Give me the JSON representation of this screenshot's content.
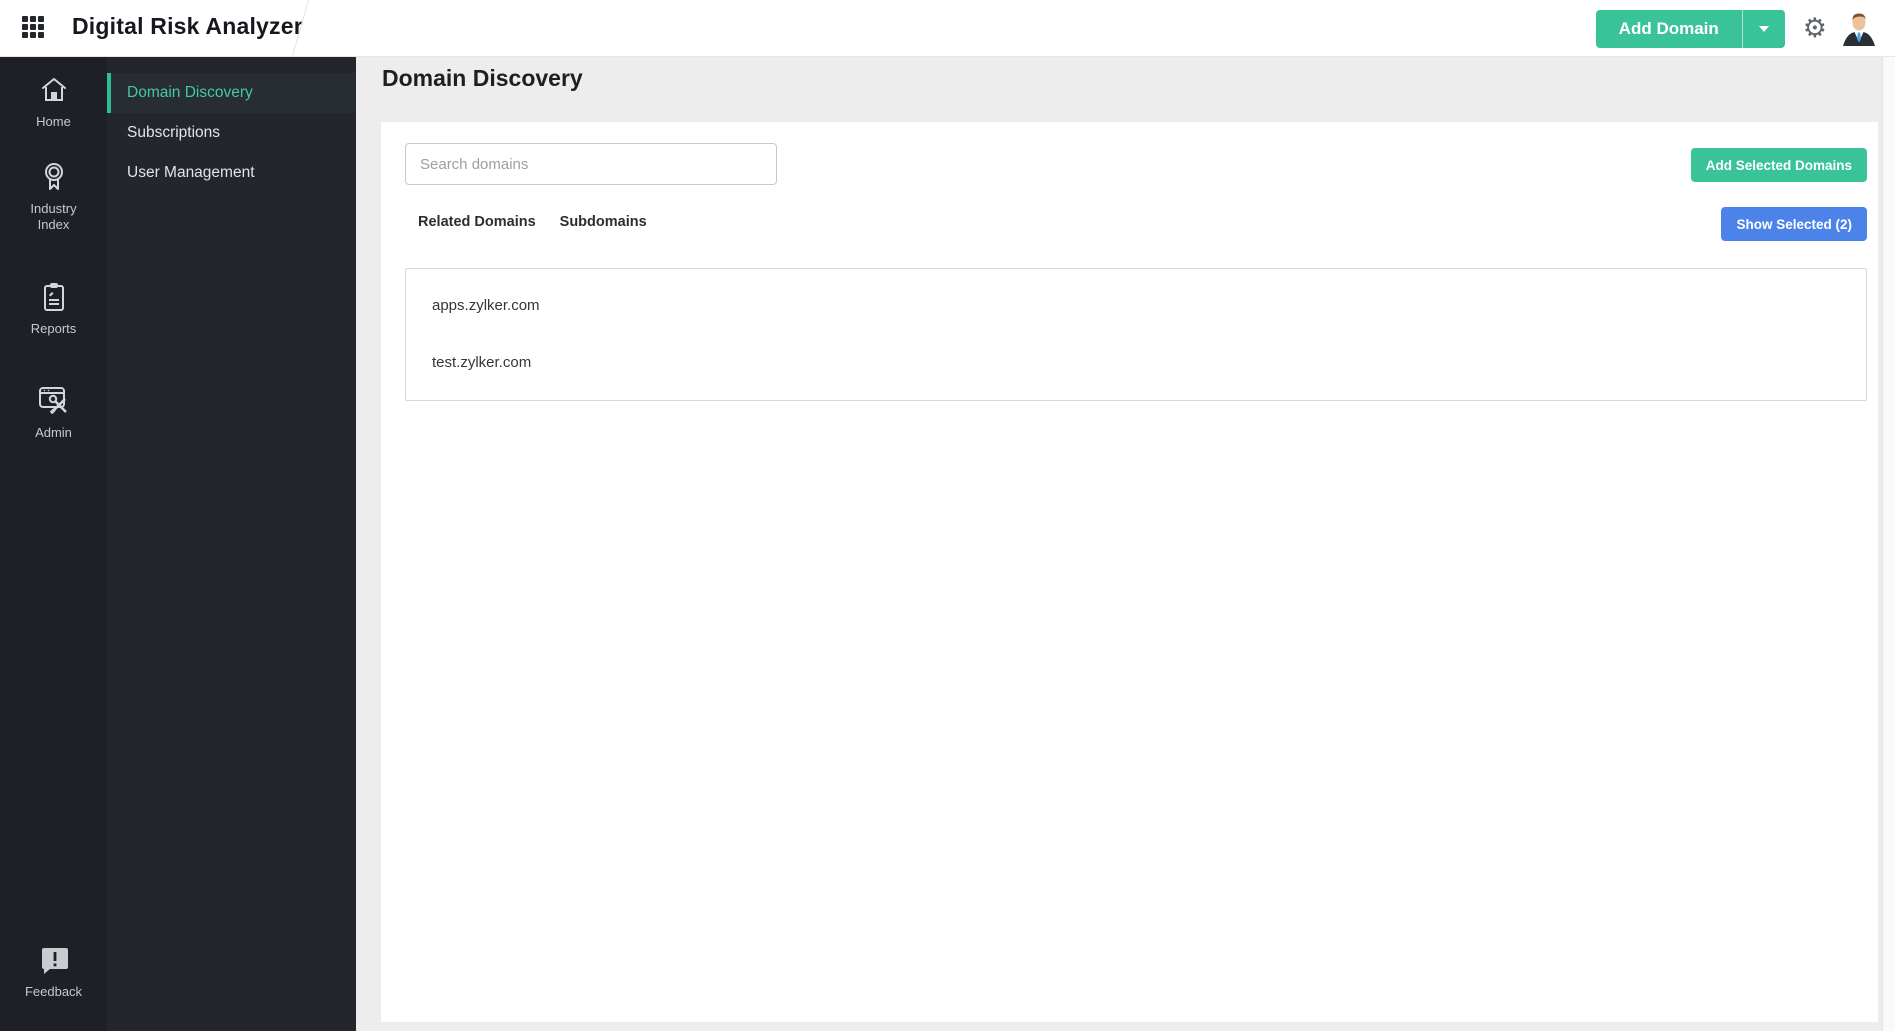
{
  "header": {
    "app_title": "Digital Risk Analyzer",
    "add_domain_label": "Add Domain"
  },
  "primary_sidebar": {
    "items": [
      {
        "label": "Home",
        "icon": "home-icon"
      },
      {
        "label": "Industry Index",
        "icon": "medal-icon"
      },
      {
        "label": "Reports",
        "icon": "report-clipboard-icon"
      },
      {
        "label": "Admin",
        "icon": "admin-tools-icon"
      }
    ],
    "feedback_label": "Feedback"
  },
  "secondary_sidebar": {
    "items": [
      {
        "label": "Domain Discovery",
        "selected": true
      },
      {
        "label": "Subscriptions",
        "selected": false
      },
      {
        "label": "User Management",
        "selected": false
      }
    ]
  },
  "main": {
    "page_title": "Domain Discovery",
    "search": {
      "placeholder": "Search domains",
      "value": ""
    },
    "tabs": [
      {
        "label": "Related Domains"
      },
      {
        "label": "Subdomains"
      }
    ],
    "buttons": {
      "add_selected": "Add Selected Domains",
      "show_selected": "Show Selected (2)"
    },
    "domain_list": [
      "apps.zylker.com",
      "test.zylker.com"
    ]
  },
  "colors": {
    "accent_green": "#3ac398",
    "accent_blue": "#4c83e9",
    "selected_teal": "#44c8a3",
    "sidebar_primary_bg": "#1d2026",
    "sidebar_secondary_bg": "#23262c"
  }
}
